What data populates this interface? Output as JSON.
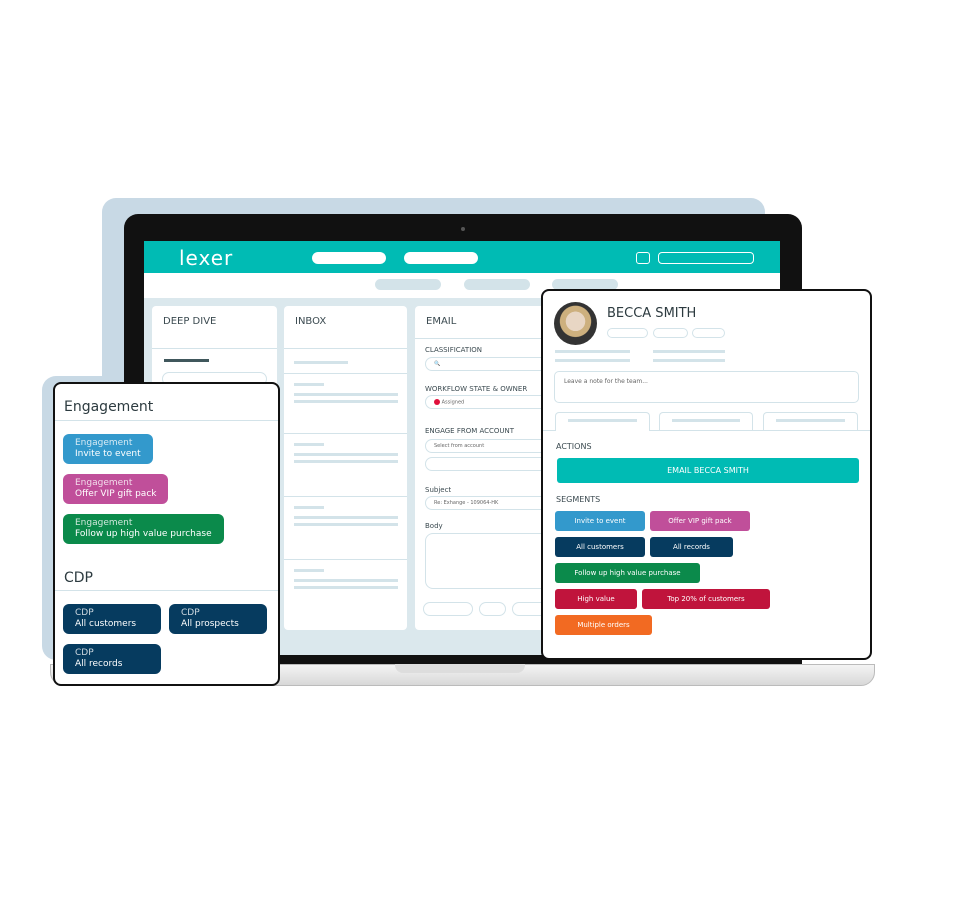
{
  "app": {
    "logo": "lexer"
  },
  "laptop": {
    "deep_dive": {
      "title": "DEEP DIVE"
    },
    "inbox": {
      "title": "INBOX"
    },
    "email": {
      "title": "EMAIL",
      "classification": "CLASSIFICATION",
      "workflow": "WORKFLOW STATE & OWNER",
      "workflow_value": "Assigned",
      "engage": "ENGAGE FROM ACCOUNT",
      "engage_placeholder": "Select from account",
      "subject": "Subject",
      "subject_value": "Re: Exhange - 109064-HK",
      "body": "Body"
    }
  },
  "engagement_card": {
    "title": "Engagement",
    "items": [
      {
        "kind": "Engagement",
        "label": "Invite to event",
        "color": "#3399cc"
      },
      {
        "kind": "Engagement",
        "label": "Offer VIP gift pack",
        "color": "#c04f9a"
      },
      {
        "kind": "Engagement",
        "label": "Follow up high value purchase",
        "color": "#0b8a4b"
      }
    ],
    "cdp_title": "CDP",
    "cdp_items": [
      {
        "kind": "CDP",
        "label": "All customers",
        "color": "#063b5f"
      },
      {
        "kind": "CDP",
        "label": "All prospects",
        "color": "#063b5f"
      },
      {
        "kind": "CDP",
        "label": "All records",
        "color": "#063b5f"
      }
    ]
  },
  "profile": {
    "name": "BECCA SMITH",
    "note_placeholder": "Leave a note for the team...",
    "actions_title": "ACTIONS",
    "email_button": "EMAIL BECCA SMITH",
    "segments_title": "SEGMENTS",
    "segments": [
      {
        "label": "Invite to event",
        "color": "#3399cc"
      },
      {
        "label": "Offer VIP gift pack",
        "color": "#c04f9a"
      },
      {
        "label": "All customers",
        "color": "#063b5f"
      },
      {
        "label": "All records",
        "color": "#063b5f"
      },
      {
        "label": "Follow up high value purchase",
        "color": "#0b8a4b"
      },
      {
        "label": "High value",
        "color": "#c0143c"
      },
      {
        "label": "Top 20% of customers",
        "color": "#c0143c"
      },
      {
        "label": "Multiple orders",
        "color": "#f26a22"
      }
    ]
  },
  "colors": {
    "brand": "#00bbb4"
  }
}
